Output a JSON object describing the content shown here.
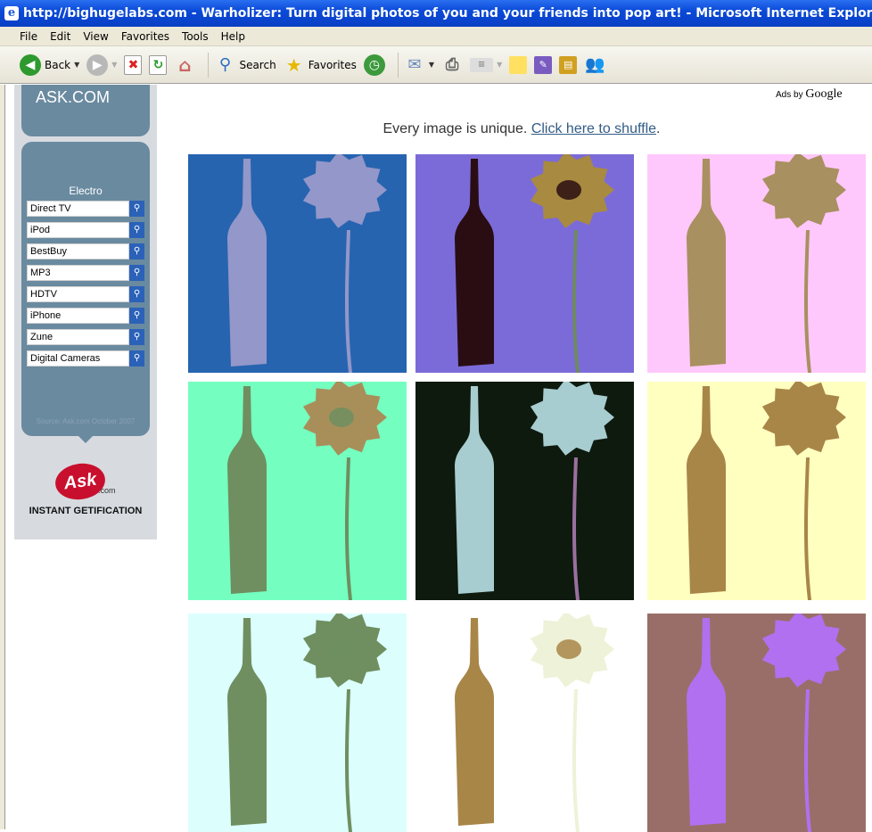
{
  "window": {
    "title": "http://bighugelabs.com - Warholizer: Turn digital photos of you and your friends into pop art! - Microsoft Internet Explorer"
  },
  "menu": [
    "File",
    "Edit",
    "View",
    "Favorites",
    "Tools",
    "Help"
  ],
  "toolbar": {
    "back_label": "Back",
    "search_label": "Search",
    "favorites_label": "Favorites"
  },
  "sidebar": {
    "ask_top_label": "ASK.COM",
    "category": "Electro",
    "items": [
      "Direct TV",
      "iPod",
      "BestBuy",
      "MP3",
      "HDTV",
      "iPhone",
      "Zune",
      "Digital Cameras"
    ],
    "source": "Source: Ask.com October 2007",
    "logo_text": "Ask",
    "logo_com": ".com",
    "tagline": "INSTANT GETIFICATION"
  },
  "ads": {
    "prefix": "Ads by",
    "brand": "Google"
  },
  "content": {
    "intro": "Every image is unique.",
    "shuffle_link": "Click here to shuffle",
    "period": "."
  },
  "tiles": [
    {
      "bg": "#2664b0",
      "bottle": "#9397c9",
      "flower": "#9397c9",
      "center": "#9397c9",
      "stem": "#9397c9"
    },
    {
      "bg": "#7b6bd9",
      "bottle": "#2a0d12",
      "flower": "#a88a40",
      "center": "#2a0d12",
      "stem": "#6f8a5f"
    },
    {
      "bg": "#ffc8fc",
      "bottle": "#a89060",
      "flower": "#a89060",
      "center": "#a89060",
      "stem": "#a89060"
    },
    {
      "bg": "#74ffc0",
      "bottle": "#6f8f60",
      "flower": "#a88f5a",
      "center": "#6f8f60",
      "stem": "#6f8f60"
    },
    {
      "bg": "#0e1a0e",
      "bottle": "#a8cdd0",
      "flower": "#a8cdd0",
      "center": "#a8cdd0",
      "stem": "#9a70a0"
    },
    {
      "bg": "#ffffc0",
      "bottle": "#a88648",
      "flower": "#a88648",
      "center": "#a88648",
      "stem": "#a88648"
    },
    {
      "bg": "#dcfffe",
      "bottle": "#6f8f60",
      "flower": "#6f8f60",
      "center": "#6f8f60",
      "stem": "#6f8f60"
    },
    {
      "bg": "#ffffff",
      "bottle": "#a88648",
      "flower": "#eef2d8",
      "center": "#a88648",
      "stem": "#eef2d8"
    },
    {
      "bg": "#9a6e68",
      "bottle": "#b070f0",
      "flower": "#b070f0",
      "center": "#b070f0",
      "stem": "#b070f0"
    }
  ]
}
